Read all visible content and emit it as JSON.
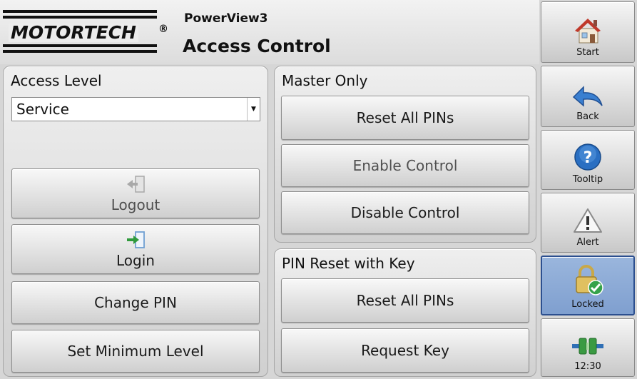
{
  "brand": {
    "logo_text": "MOTORTECH",
    "registered": "®"
  },
  "header": {
    "app_name": "PowerView3",
    "page_title": "Access Control"
  },
  "access_level": {
    "title": "Access Level",
    "selected": "Service",
    "logout_label": "Logout",
    "login_label": "Login",
    "change_pin_label": "Change PIN",
    "set_min_level_label": "Set Minimum Level"
  },
  "master_only": {
    "title": "Master Only",
    "reset_all_pins_label": "Reset All PINs",
    "enable_control_label": "Enable Control",
    "disable_control_label": "Disable Control"
  },
  "pin_reset_key": {
    "title": "PIN Reset with Key",
    "reset_all_pins_label": "Reset All PINs",
    "request_key_label": "Request Key"
  },
  "sidebar": {
    "start_label": "Start",
    "back_label": "Back",
    "tooltip_label": "Tooltip",
    "alert_label": "Alert",
    "locked_label": "Locked",
    "clock_label": "12:30"
  },
  "colors": {
    "active_blue": "#8faad6",
    "active_border": "#2c4f8f",
    "house_roof": "#c0392b",
    "help_blue": "#2a6fc2",
    "check_green": "#35a24a"
  }
}
